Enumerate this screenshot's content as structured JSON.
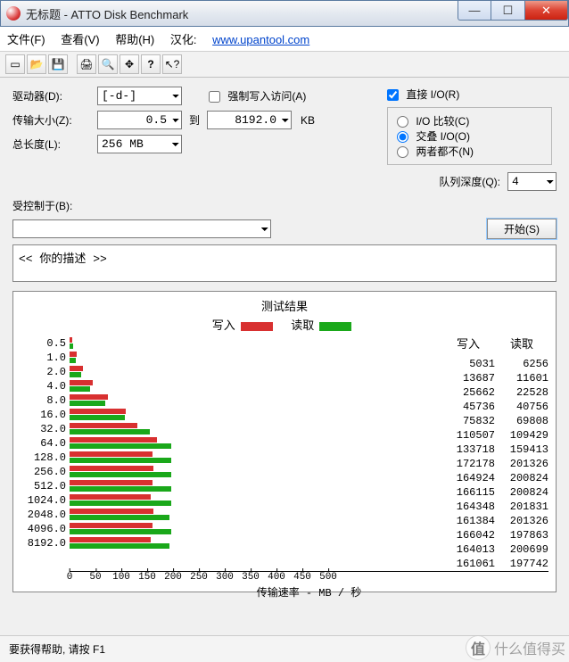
{
  "window": {
    "title": "无标题 - ATTO Disk Benchmark"
  },
  "menu": {
    "file": "文件(F)",
    "view": "查看(V)",
    "help": "帮助(H)",
    "l10n_label": "汉化:",
    "l10n_url": "www.upantool.com"
  },
  "form": {
    "drive_label": "驱动器(D):",
    "drive_value": "[-d-]",
    "size_label": "传输大小(Z):",
    "size_from": "0.5",
    "to_label": "到",
    "size_to": "8192.0",
    "kb": "KB",
    "length_label": "总长度(L):",
    "length_value": "256 MB",
    "force_write": "强制写入访问(A)",
    "direct_io": "直接 I/O(R)",
    "io_compare": "I/O 比较(C)",
    "overlapped_io": "交叠 I/O(O)",
    "neither": "两者都不(N)",
    "queue_label": "队列深度(Q):",
    "queue_value": "4",
    "controlled_label": "受控制于(B):",
    "controlled_value": "",
    "start": "开始(S)",
    "desc": "<<  你的描述   >>"
  },
  "results": {
    "title": "测试结果",
    "write_label": "写入",
    "read_label": "读取",
    "xlabel": "传输速率 - MB / 秒"
  },
  "chart_data": {
    "type": "bar",
    "orientation": "horizontal",
    "series": [
      {
        "name": "写入",
        "color": "#d83030",
        "values_kb": [
          5031,
          13687,
          25662,
          45736,
          75832,
          110507,
          133718,
          172178,
          164924,
          166115,
          164348,
          161384,
          166042,
          164013,
          161061
        ]
      },
      {
        "name": "读取",
        "color": "#1aa81a",
        "values_kb": [
          6256,
          11601,
          22528,
          40756,
          69808,
          109429,
          159413,
          201326,
          200824,
          200824,
          201831,
          201326,
          197863,
          200699,
          197742
        ]
      }
    ],
    "categories": [
      "0.5",
      "1.0",
      "2.0",
      "4.0",
      "8.0",
      "16.0",
      "32.0",
      "64.0",
      "128.0",
      "256.0",
      "512.0",
      "1024.0",
      "2048.0",
      "4096.0",
      "8192.0"
    ],
    "xticks": [
      0,
      50,
      100,
      150,
      200,
      250,
      300,
      350,
      400,
      450,
      500
    ],
    "xlim": [
      0,
      500
    ],
    "xlabel": "传输速率 - MB / 秒",
    "x_unit": "MB/s",
    "value_unit": "KB/s"
  },
  "status": {
    "text": "要获得帮助, 请按 F1"
  },
  "watermark": {
    "text": "什么值得买",
    "icon": "值"
  }
}
